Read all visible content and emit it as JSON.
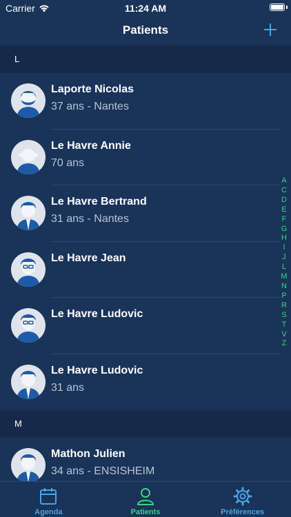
{
  "status_bar": {
    "carrier": "Carrier",
    "time": "11:24 AM"
  },
  "nav": {
    "title": "Patients",
    "add_icon": "plus-icon"
  },
  "colors": {
    "background": "#1a3358",
    "section": "#17294a",
    "accent": "#4aa3e8",
    "index": "#3bd47e",
    "active_tab": "#3bd47e"
  },
  "sections": [
    {
      "letter": "L",
      "patients": [
        {
          "name": "Laporte Nicolas",
          "detail": "37 ans - Nantes"
        },
        {
          "name": "Le Havre Annie",
          "detail": "70 ans"
        },
        {
          "name": "Le Havre Bertrand",
          "detail": "31 ans - Nantes"
        },
        {
          "name": "Le Havre Jean",
          "detail": ""
        },
        {
          "name": "Le Havre Ludovic",
          "detail": ""
        },
        {
          "name": "Le Havre Ludovic",
          "detail": "31 ans"
        }
      ]
    },
    {
      "letter": "M",
      "patients": [
        {
          "name": "Mathon Julien",
          "detail": "34 ans - ENSISHEIM"
        }
      ]
    }
  ],
  "index_letters": [
    "A",
    "C",
    "D",
    "E",
    "F",
    "G",
    "H",
    "I",
    "J",
    "L",
    "M",
    "N",
    "P",
    "R",
    "S",
    "T",
    "V",
    "Z"
  ],
  "tabs": [
    {
      "label": "Agenda",
      "icon": "calendar-icon",
      "active": false
    },
    {
      "label": "Patients",
      "icon": "person-icon",
      "active": true
    },
    {
      "label": "Préférences",
      "icon": "gear-icon",
      "active": false
    }
  ]
}
